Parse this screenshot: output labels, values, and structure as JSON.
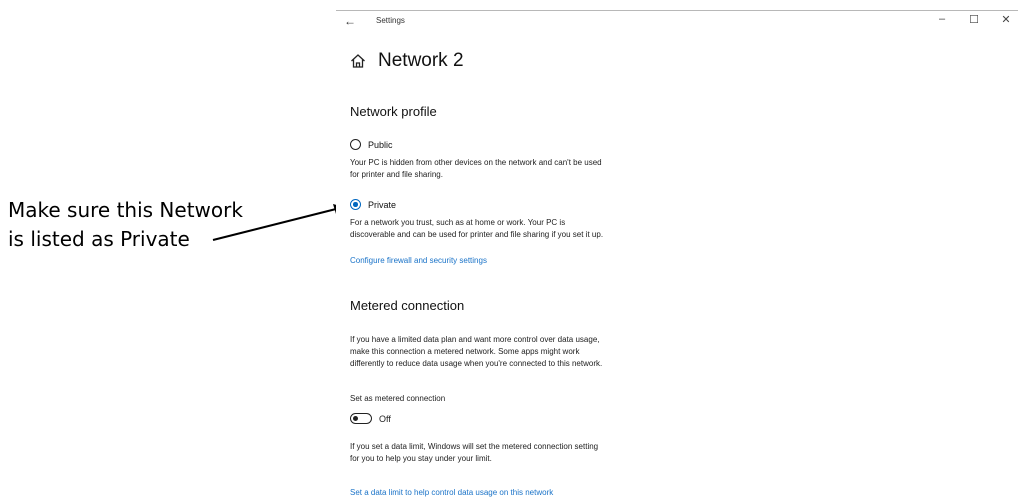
{
  "annotation": {
    "line1": "Make sure this Network",
    "line2": "is listed as Private"
  },
  "titlebar": {
    "back_icon": "←",
    "title": "Settings",
    "minimize": "–",
    "maximize": "☐",
    "close": "✕"
  },
  "page": {
    "title": "Network 2"
  },
  "network_profile": {
    "heading": "Network profile",
    "public": {
      "label": "Public",
      "description_1": "Your PC is hidden from other devices on the network and can't be used",
      "description_2": "for printer and file sharing.",
      "checked": false
    },
    "private": {
      "label": "Private",
      "description_1": "For a network you trust, such as at home or work. Your PC is",
      "description_2": "discoverable and can be used for printer and file sharing if you set it up.",
      "checked": true
    },
    "firewall_link": "Configure firewall and security settings"
  },
  "metered": {
    "heading": "Metered connection",
    "description_1": "If you have a limited data plan and want more control over data usage,",
    "description_2": "make this connection a metered network. Some apps might work",
    "description_3": "differently to reduce data usage when you're connected to this network.",
    "toggle_heading": "Set as metered connection",
    "toggle_state": "Off",
    "limit_text_1": "If you set a data limit, Windows will set the metered connection setting",
    "limit_text_2": "for you to help you stay under your limit.",
    "limit_link": "Set a data limit to help control data usage on this network"
  },
  "colors": {
    "accent": "#0067c0",
    "link": "#1a73c8"
  }
}
